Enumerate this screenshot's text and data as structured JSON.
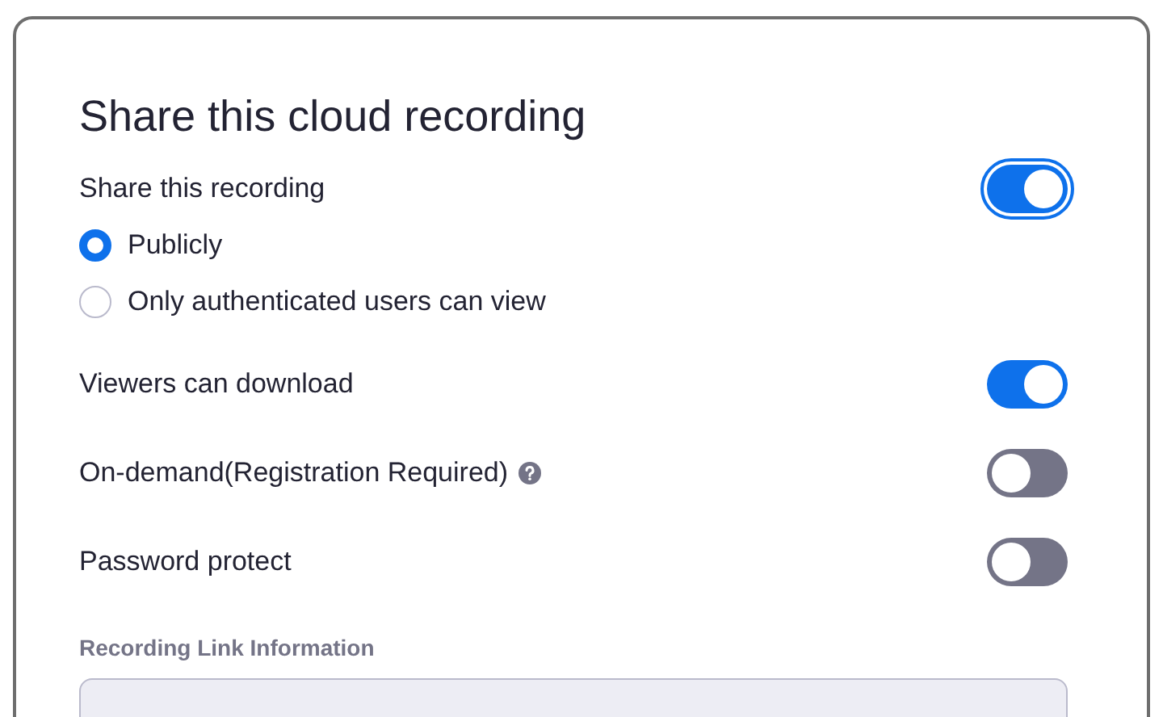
{
  "dialog": {
    "title": "Share this cloud recording",
    "share": {
      "label": "Share this recording",
      "on": true,
      "focused": true
    },
    "visibility_options": [
      {
        "label": "Publicly",
        "selected": true
      },
      {
        "label": "Only authenticated users can view",
        "selected": false
      }
    ],
    "settings": [
      {
        "kind": "plain",
        "label": "Viewers can download",
        "on": true
      },
      {
        "kind": "help",
        "label": "On-demand(Registration Required)",
        "on": false
      },
      {
        "kind": "plain",
        "label": "Password protect",
        "on": false
      }
    ],
    "link_section": {
      "label": "Recording Link Information"
    }
  }
}
